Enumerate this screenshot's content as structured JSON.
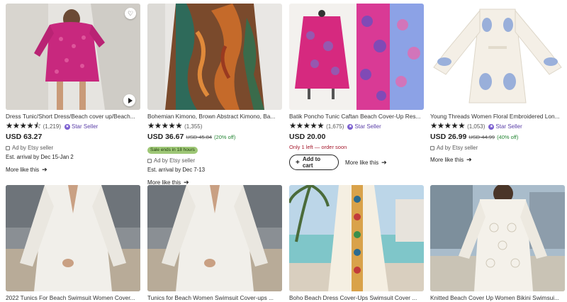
{
  "listings_row1": [
    {
      "title": "Dress Tunic/Short Dress/Beach cover up/Beach...",
      "stars": "★★★★⯪",
      "count": "(1,219)",
      "star_seller": "Star Seller",
      "price": "USD 63.27",
      "ad": "Ad by Etsy seller",
      "arrival": "Est. arrival by Dec 15-Jan 2",
      "more": "More like this"
    },
    {
      "title": "Bohemian Kimono, Brown Abstract Kimono, Ba...",
      "stars": "★★★★★",
      "count": "(1,355)",
      "price": "USD 36.67",
      "original_price": "USD 45.84",
      "discount": "(20% off)",
      "sale_badge": "Sale ends in 18 hours",
      "ad": "Ad by Etsy seller",
      "arrival": "Est. arrival by Dec 7-13",
      "more": "More like this"
    },
    {
      "title": "Batik Poncho Tunic Caftan Beach Cover-Up Res...",
      "stars": "★★★★★",
      "count": "(1,675)",
      "star_seller": "Star Seller",
      "price": "USD 20.00",
      "low_stock": "Only 1 left — order soon",
      "cart": "Add to cart",
      "more": "More like this"
    },
    {
      "title": "Young Threads Women Floral Embroidered Lon...",
      "stars": "★★★★★",
      "count": "(1,053)",
      "star_seller": "Star Seller",
      "price": "USD 26.99",
      "original_price": "USD 44.99",
      "discount": "(40% off)",
      "ad": "Ad by Etsy seller",
      "more": "More like this"
    }
  ],
  "listings_row2": [
    {
      "title": "2022 Tunics For Beach Swimsuit Women Cover..."
    },
    {
      "title": "Tunics for Beach Women Swimsuit Cover-ups ..."
    },
    {
      "title": "Boho Beach Dress Cover-Ups Swimsuit Cover ..."
    },
    {
      "title": "Knitted Beach Cover Up Women Bikini Swimsui..."
    }
  ],
  "icons": {
    "favorite": "heart-icon",
    "video": "play-icon",
    "ad": "ad-icon",
    "cart": "plus-icon",
    "arrow": "arrow-right-icon"
  },
  "colors": {
    "star_seller": "#5b3fa8",
    "discount": "#258635",
    "low_stock": "#a61a2e",
    "sale_badge": "#9ec776"
  }
}
